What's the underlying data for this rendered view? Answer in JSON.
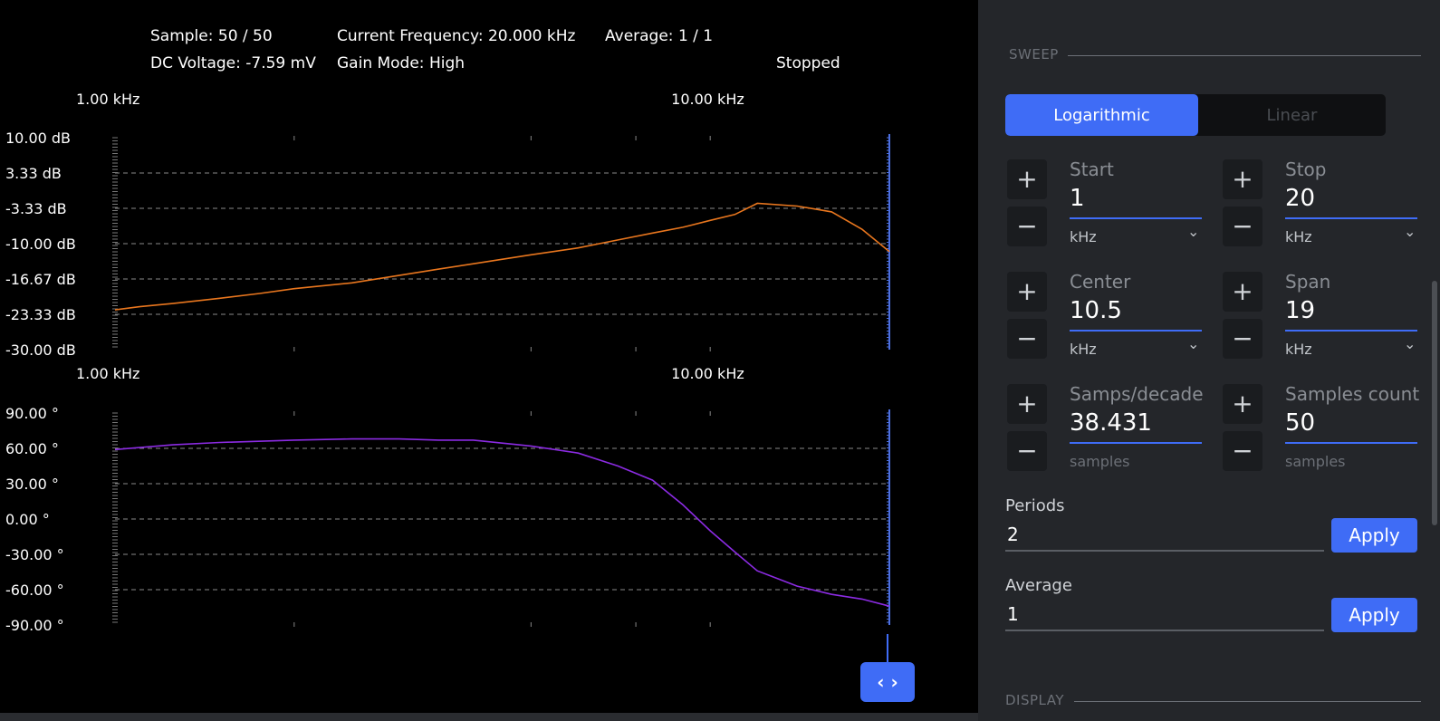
{
  "status": {
    "sample": "Sample: 50 / 50",
    "current_frequency": "Current Frequency: 20.000 kHz",
    "average": "Average: 1 / 1",
    "dc_voltage": "DC Voltage: -7.59 mV",
    "gain_mode": "Gain Mode: High",
    "state": "Stopped"
  },
  "magnitude_plot": {
    "x_labels": [
      "1.00 kHz",
      "10.00 kHz"
    ],
    "y_labels": [
      "10.00 dB",
      "3.33 dB",
      "-3.33 dB",
      "-10.00 dB",
      "-16.67 dB",
      "-23.33 dB",
      "-30.00 dB"
    ],
    "color": "#e8761e"
  },
  "phase_plot": {
    "x_labels": [
      "1.00 kHz",
      "10.00 kHz"
    ],
    "y_labels": [
      "90.00 °",
      "60.00 °",
      "30.00 °",
      "0.00 °",
      "-30.00 °",
      "-60.00 °",
      "-90.00 °"
    ],
    "color": "#8b2be2"
  },
  "chart_data": [
    {
      "type": "line",
      "x_scale": "log",
      "x_unit": "kHz",
      "xlim": [
        1,
        20
      ],
      "ylim": [
        -30,
        10
      ],
      "y_unit": "dB",
      "series": [
        {
          "x": [
            1,
            1.1,
            1.25,
            1.5,
            1.75,
            2,
            2.5,
            3,
            3.5,
            4,
            5,
            6,
            7,
            8,
            9,
            10,
            11,
            12,
            14,
            16,
            18,
            20
          ],
          "values": [
            -22.5,
            -21.9,
            -21.3,
            -20.3,
            -19.4,
            -18.5,
            -17.4,
            -16.0,
            -14.8,
            -13.8,
            -12.1,
            -10.8,
            -9.3,
            -8.0,
            -6.9,
            -5.6,
            -4.5,
            -2.4,
            -2.9,
            -4.0,
            -7.3,
            -11.5
          ]
        }
      ]
    },
    {
      "type": "line",
      "x_scale": "log",
      "x_unit": "kHz",
      "xlim": [
        1,
        20
      ],
      "ylim": [
        -90,
        90
      ],
      "y_unit": "°",
      "series": [
        {
          "x": [
            1,
            1.25,
            1.5,
            2,
            2.5,
            3,
            3.5,
            4,
            5,
            6,
            7,
            8,
            9,
            10,
            11,
            12,
            14,
            16,
            18,
            20
          ],
          "values": [
            59,
            63,
            65,
            67,
            68,
            68,
            67,
            67,
            62,
            56,
            45,
            33,
            12,
            -10,
            -28,
            -44,
            -57,
            -64,
            -68,
            -74
          ]
        }
      ]
    }
  ],
  "scroll_handle": {
    "icon": "code-chevrons-icon",
    "glyph": "‹ ›"
  },
  "sweep": {
    "section_title": "SWEEP",
    "modes": [
      "Logarithmic",
      "Linear"
    ],
    "active_mode": "Logarithmic",
    "plus": "+",
    "minus": "−",
    "chevron": "⌄",
    "fields": {
      "start": {
        "label": "Start",
        "value": "1",
        "unit": "kHz"
      },
      "stop": {
        "label": "Stop",
        "value": "20",
        "unit": "kHz"
      },
      "center": {
        "label": "Center",
        "value": "10.5",
        "unit": "kHz"
      },
      "span": {
        "label": "Span",
        "value": "19",
        "unit": "kHz"
      },
      "samps_per_decade": {
        "label": "Samps/decade",
        "value": "38.431",
        "unit": "samples"
      },
      "samples_count": {
        "label": "Samples count",
        "value": "50",
        "unit": "samples"
      }
    },
    "periods": {
      "label": "Periods",
      "value": "2",
      "apply": "Apply"
    },
    "average": {
      "label": "Average",
      "value": "1",
      "apply": "Apply"
    }
  },
  "display": {
    "section_title": "DISPLAY"
  },
  "colors": {
    "accent": "#3f6cf6",
    "panel_bg": "#24262a",
    "magnitude": "#e8761e",
    "phase": "#8b2be2"
  }
}
